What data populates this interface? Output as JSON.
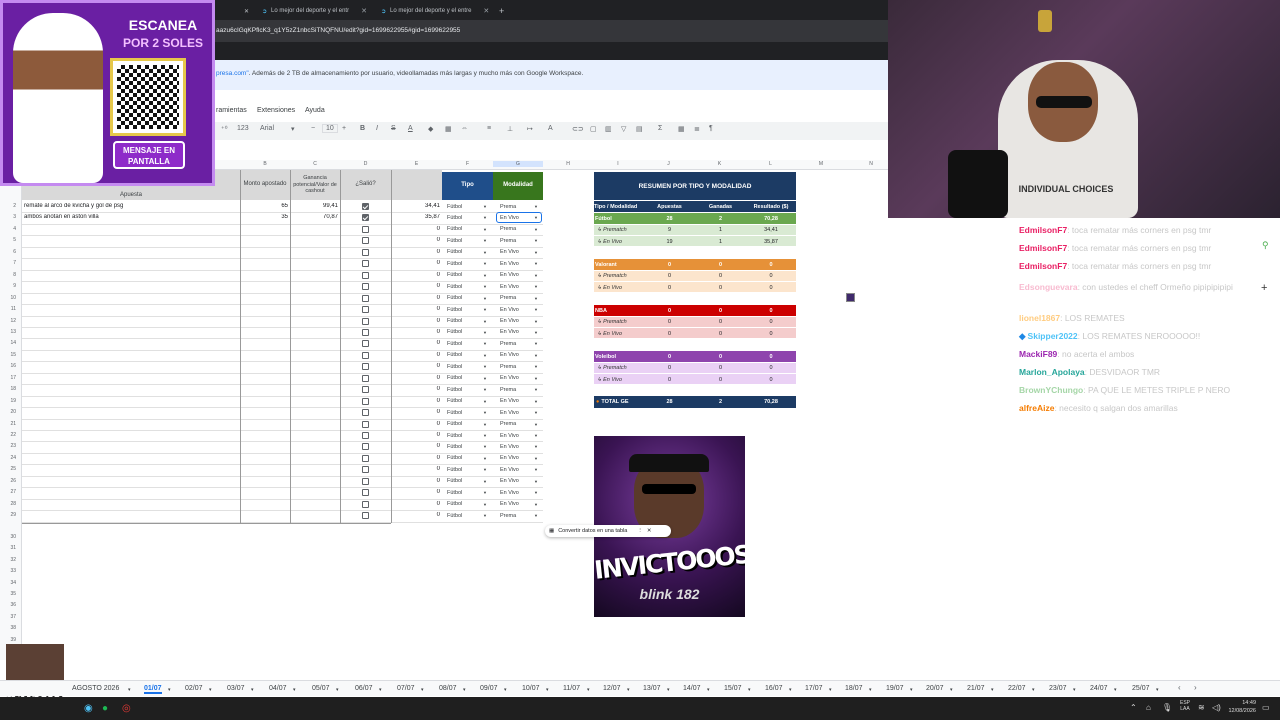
{
  "browser": {
    "tabs": [
      {
        "label": "Lo mejor del deporte y el entr"
      },
      {
        "label": "Lo mejor del deporte y el entre"
      }
    ],
    "new_tab": "+",
    "url": "aazu6cIGqKPflcK3_q1Y5zZ1nbcSiTNQFNU/edit?gid=1699622955#gid=1699622955"
  },
  "promo_banner": {
    "link": "presa.com\"",
    "text": ". Además de 2 TB de almacenamiento por usuario, videollamadas más largas y mucho más con Google Workspace."
  },
  "menu": [
    "ramientas",
    "Extensiones",
    "Ayuda"
  ],
  "toolbar": {
    "font": "Arial",
    "size": "10",
    "format_num": "123"
  },
  "columns": [
    "B",
    "C",
    "D",
    "E",
    "F",
    "G",
    "H",
    "I",
    "J",
    "K",
    "L",
    "M",
    "N"
  ],
  "table": {
    "headers": {
      "apuesta": "Apuesta",
      "monto": "Monto apostado",
      "ganancia": "Ganancia potencial/Valor de cashout",
      "salio": "¿Salió?",
      "tipo": "Tipo",
      "modalidad": "Modalidad"
    },
    "rows": [
      {
        "n": "2",
        "apuesta": "remate al arco de kvicha y gol de psg",
        "monto": "65",
        "ganancia": "99,41",
        "salio": true,
        "resultado": "34,41",
        "tipo": "Fútbol",
        "modalidad": "Prema"
      },
      {
        "n": "3",
        "apuesta": "ambos anotan en aston villa",
        "monto": "35",
        "ganancia": "70,87",
        "salio": true,
        "resultado": "35,87",
        "tipo": "Fútbol",
        "modalidad": "En Vivo"
      },
      {
        "n": "4",
        "apuesta": "",
        "monto": "",
        "ganancia": "",
        "salio": false,
        "resultado": "0",
        "tipo": "Fútbol",
        "modalidad": "Prema"
      },
      {
        "n": "5",
        "apuesta": "",
        "monto": "",
        "ganancia": "",
        "salio": false,
        "resultado": "0",
        "tipo": "Fútbol",
        "modalidad": "Prema"
      },
      {
        "n": "6",
        "apuesta": "",
        "monto": "",
        "ganancia": "",
        "salio": false,
        "resultado": "0",
        "tipo": "Fútbol",
        "modalidad": "En Vivo"
      },
      {
        "n": "7",
        "apuesta": "",
        "monto": "",
        "ganancia": "",
        "salio": false,
        "resultado": "0",
        "tipo": "Fútbol",
        "modalidad": "En Vivo"
      },
      {
        "n": "8",
        "apuesta": "",
        "monto": "",
        "ganancia": "",
        "salio": false,
        "resultado": "0",
        "tipo": "Fútbol",
        "modalidad": "En Vivo"
      },
      {
        "n": "9",
        "apuesta": "",
        "monto": "",
        "ganancia": "",
        "salio": false,
        "resultado": "0",
        "tipo": "Fútbol",
        "modalidad": "En Vivo"
      },
      {
        "n": "10",
        "apuesta": "",
        "monto": "",
        "ganancia": "",
        "salio": false,
        "resultado": "0",
        "tipo": "Fútbol",
        "modalidad": "Prema"
      },
      {
        "n": "11",
        "apuesta": "",
        "monto": "",
        "ganancia": "",
        "salio": false,
        "resultado": "0",
        "tipo": "Fútbol",
        "modalidad": "En Vivo"
      },
      {
        "n": "12",
        "apuesta": "",
        "monto": "",
        "ganancia": "",
        "salio": false,
        "resultado": "0",
        "tipo": "Fútbol",
        "modalidad": "En Vivo"
      },
      {
        "n": "13",
        "apuesta": "",
        "monto": "",
        "ganancia": "",
        "salio": false,
        "resultado": "0",
        "tipo": "Fútbol",
        "modalidad": "En Vivo"
      },
      {
        "n": "14",
        "apuesta": "",
        "monto": "",
        "ganancia": "",
        "salio": false,
        "resultado": "0",
        "tipo": "Fútbol",
        "modalidad": "Prema"
      },
      {
        "n": "15",
        "apuesta": "",
        "monto": "",
        "ganancia": "",
        "salio": false,
        "resultado": "0",
        "tipo": "Fútbol",
        "modalidad": "En Vivo"
      },
      {
        "n": "16",
        "apuesta": "",
        "monto": "",
        "ganancia": "",
        "salio": false,
        "resultado": "0",
        "tipo": "Fútbol",
        "modalidad": "Prema"
      },
      {
        "n": "17",
        "apuesta": "",
        "monto": "",
        "ganancia": "",
        "salio": false,
        "resultado": "0",
        "tipo": "Fútbol",
        "modalidad": "En Vivo"
      },
      {
        "n": "18",
        "apuesta": "",
        "monto": "",
        "ganancia": "",
        "salio": false,
        "resultado": "0",
        "tipo": "Fútbol",
        "modalidad": "Prema"
      },
      {
        "n": "19",
        "apuesta": "",
        "monto": "",
        "ganancia": "",
        "salio": false,
        "resultado": "0",
        "tipo": "Fútbol",
        "modalidad": "En Vivo"
      },
      {
        "n": "20",
        "apuesta": "",
        "monto": "",
        "ganancia": "",
        "salio": false,
        "resultado": "0",
        "tipo": "Fútbol",
        "modalidad": "En Vivo"
      },
      {
        "n": "21",
        "apuesta": "",
        "monto": "",
        "ganancia": "",
        "salio": false,
        "resultado": "0",
        "tipo": "Fútbol",
        "modalidad": "Prema"
      },
      {
        "n": "22",
        "apuesta": "",
        "monto": "",
        "ganancia": "",
        "salio": false,
        "resultado": "0",
        "tipo": "Fútbol",
        "modalidad": "En Vivo"
      },
      {
        "n": "23",
        "apuesta": "",
        "monto": "",
        "ganancia": "",
        "salio": false,
        "resultado": "0",
        "tipo": "Fútbol",
        "modalidad": "En Vivo"
      },
      {
        "n": "24",
        "apuesta": "",
        "monto": "",
        "ganancia": "",
        "salio": false,
        "resultado": "0",
        "tipo": "Fútbol",
        "modalidad": "En Vivo"
      },
      {
        "n": "25",
        "apuesta": "",
        "monto": "",
        "ganancia": "",
        "salio": false,
        "resultado": "0",
        "tipo": "Fútbol",
        "modalidad": "En Vivo"
      },
      {
        "n": "26",
        "apuesta": "",
        "monto": "",
        "ganancia": "",
        "salio": false,
        "resultado": "0",
        "tipo": "Fútbol",
        "modalidad": "En Vivo"
      },
      {
        "n": "27",
        "apuesta": "",
        "monto": "",
        "ganancia": "",
        "salio": false,
        "resultado": "0",
        "tipo": "Fútbol",
        "modalidad": "En Vivo"
      },
      {
        "n": "28",
        "apuesta": "",
        "monto": "",
        "ganancia": "",
        "salio": false,
        "resultado": "0",
        "tipo": "Fútbol",
        "modalidad": "En Vivo"
      },
      {
        "n": "29",
        "apuesta": "",
        "monto": "",
        "ganancia": "",
        "salio": false,
        "resultado": "0",
        "tipo": "Fútbol",
        "modalidad": "Prema"
      }
    ],
    "trailing_rows": [
      "30",
      "31",
      "32",
      "33",
      "34",
      "35",
      "36",
      "37",
      "38",
      "39",
      "40"
    ]
  },
  "summary": {
    "title": "RESUMEN POR TIPO Y MODALIDAD",
    "headers": [
      "Tipo / Modalidad",
      "Apuestas",
      "Ganadas",
      "Resultado ($)"
    ],
    "groups": [
      {
        "name": "Fútbol",
        "apuestas": "28",
        "ganadas": "2",
        "resultado": "70,28",
        "color": "#6aa84f",
        "sub": "#d9ead3",
        "rows": [
          {
            "label": "↳ Prematch",
            "a": "9",
            "g": "1",
            "r": "34,41"
          },
          {
            "label": "↳ En Vivo",
            "a": "19",
            "g": "1",
            "r": "35,87"
          }
        ]
      },
      {
        "name": "Valorant",
        "apuestas": "0",
        "ganadas": "0",
        "resultado": "0",
        "color": "#e69138",
        "sub": "#fce5cd",
        "rows": [
          {
            "label": "↳ Prematch",
            "a": "0",
            "g": "0",
            "r": "0"
          },
          {
            "label": "↳ En Vivo",
            "a": "0",
            "g": "0",
            "r": "0"
          }
        ]
      },
      {
        "name": "NBA",
        "apuestas": "0",
        "ganadas": "0",
        "resultado": "0",
        "color": "#cc0000",
        "sub": "#f4cccc",
        "rows": [
          {
            "label": "↳ Prematch",
            "a": "0",
            "g": "0",
            "r": "0"
          },
          {
            "label": "↳ En Vivo",
            "a": "0",
            "g": "0",
            "r": "0"
          }
        ]
      },
      {
        "name": "Voleibol",
        "apuestas": "0",
        "ganadas": "0",
        "resultado": "0",
        "color": "#8e44ad",
        "sub": "#ead1f5",
        "rows": [
          {
            "label": "↳ Prematch",
            "a": "0",
            "g": "0",
            "r": "0"
          },
          {
            "label": "↳ En Vivo",
            "a": "0",
            "g": "0",
            "r": "0"
          }
        ]
      }
    ],
    "total": {
      "label": "TOTAL GE",
      "apuestas": "28",
      "ganadas": "2",
      "resultado": "70,28"
    }
  },
  "thumbnail": {
    "text": "INVICTOOOS",
    "sub": "blink 182"
  },
  "convert_tooltip": "Convertir datos en una tabla",
  "qr_promo": {
    "title": "ESCANEA",
    "subtitle": "POR 2 SOLES",
    "cta": "MENSAJE EN PANTALLA"
  },
  "webcam": {
    "shirt_text": "INDIVIDUAL CHOICES"
  },
  "chat": [
    {
      "user": "EdmilsonF7",
      "color": "#e91e63",
      "msg": ": toca rematar más corners en psg tmr"
    },
    {
      "user": "EdmilsonF7",
      "color": "#e91e63",
      "msg": ": toca rematar más corners en psg tmr"
    },
    {
      "user": "EdmilsonF7",
      "color": "#e91e63",
      "msg": ": toca rematar más corners en psg tmr"
    },
    {
      "user": "Edsonguevara",
      "color": "#f8bbd0",
      "msg": ": con ustedes el cheff Ormeño pipipipipipi"
    },
    {
      "user": "lionel1867",
      "color": "#ffcc80",
      "msg": ": LOS REMATES"
    },
    {
      "user": "Skipper2022",
      "color": "#4fc3f7",
      "msg": ": LOS REMATES NEROOOOO!!"
    },
    {
      "user": "MackiF89",
      "color": "#9c27b0",
      "msg": ": no acerta el ambos"
    },
    {
      "user": "Marlon_Apolaya",
      "color": "#26a69a",
      "msg": ": DESVIDAOR TMR"
    },
    {
      "user": "BrownYChungo",
      "color": "#a5d6a7",
      "msg": ": PA QUE LE METES TRIPLE P NERO"
    },
    {
      "user": "alfreAize",
      "color": "#f57c00",
      "msg": ": necesito q salgan dos amarillas"
    }
  ],
  "viewer_count": "x492",
  "sheet_tabs": [
    "AGOSTO 2026",
    "01/07",
    "02/07",
    "03/07",
    "04/07",
    "05/07",
    "06/07",
    "07/07",
    "08/07",
    "09/07",
    "10/07",
    "11/07",
    "12/07",
    "13/07",
    "14/07",
    "15/07",
    "16/07",
    "17/07",
    "18/07",
    "19/07",
    "20/07",
    "21/07",
    "22/07",
    "23/07",
    "24/07",
    "25/07"
  ],
  "active_tab": "01/07",
  "taskbar": {
    "lang": "ESP LAA",
    "time": "14:49",
    "date": "12/08/2026"
  }
}
